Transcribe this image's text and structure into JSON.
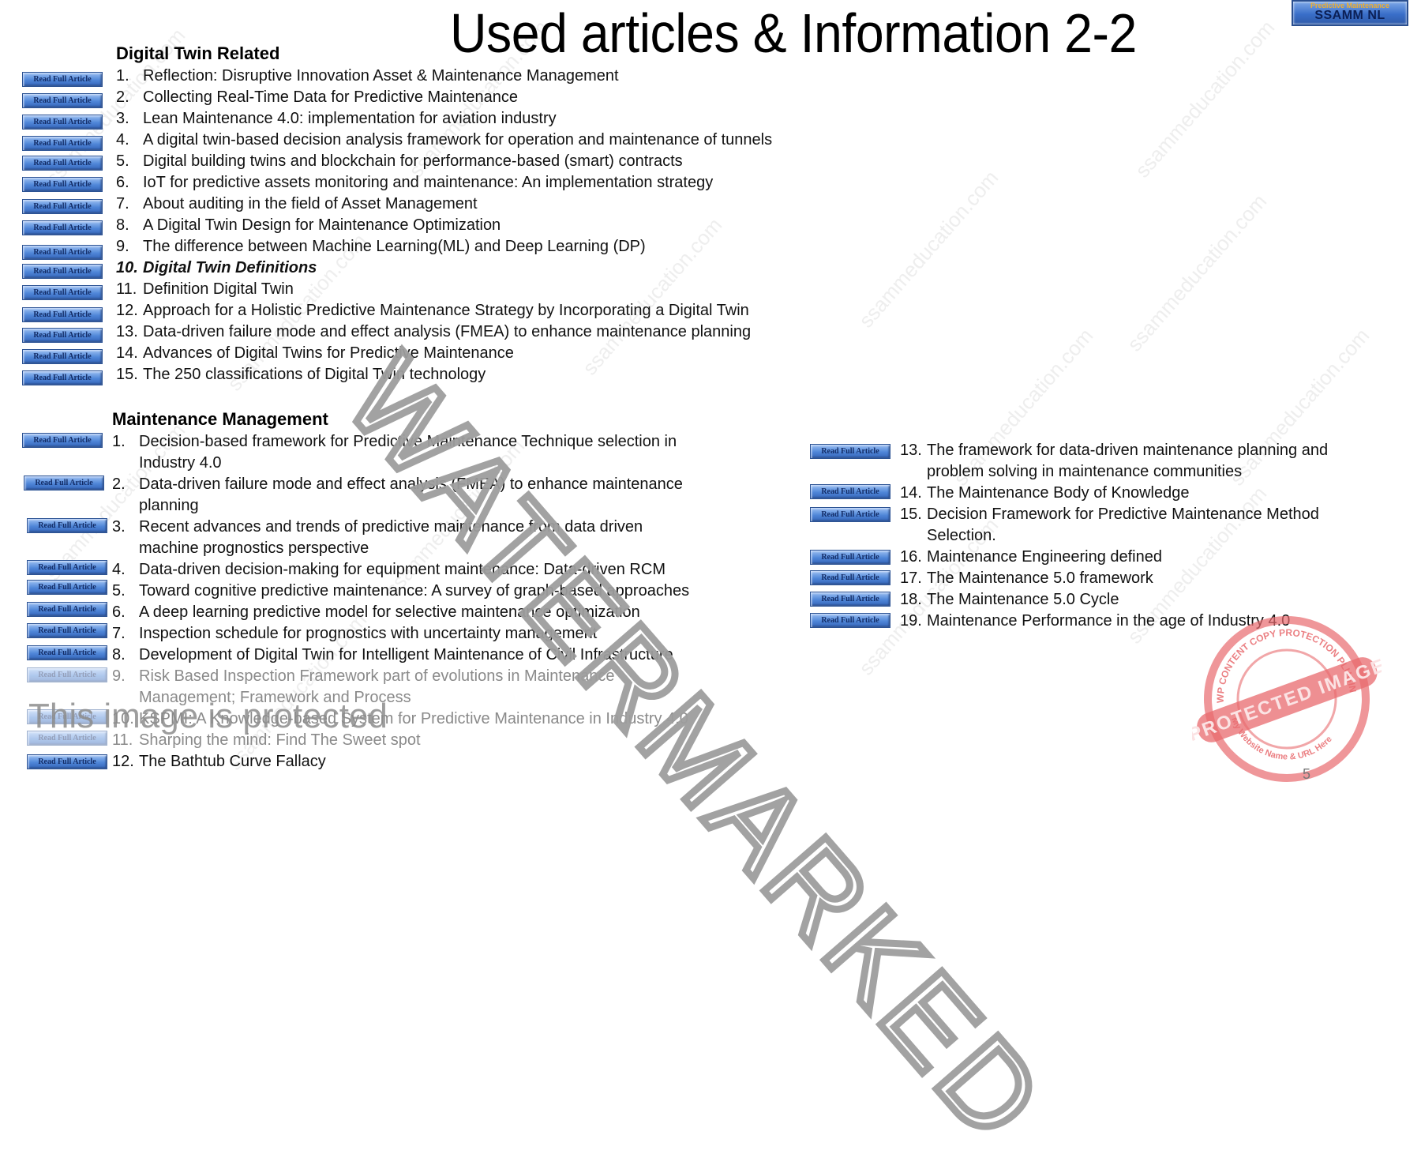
{
  "slide": {
    "title": "Used articles & Information 2-2",
    "page_number": "5",
    "logo": {
      "top_text": "Predictive Maintenance",
      "main_text": "SSAMM NL"
    },
    "button_label": "Read Full Article"
  },
  "digital_twin": {
    "heading": "Digital Twin Related",
    "items": [
      {
        "num": "1.",
        "text": "Reflection: Disruptive Innovation Asset & Maintenance Management"
      },
      {
        "num": "2.",
        "text": "Collecting Real-Time Data for Predictive Maintenance"
      },
      {
        "num": "3.",
        "text": "Lean Maintenance 4.0: implementation for aviation industry"
      },
      {
        "num": "4.",
        "text": "A digital twin-based decision analysis framework for operation and maintenance of tunnels"
      },
      {
        "num": "5.",
        "text": "Digital building twins and blockchain for performance-based (smart) contracts"
      },
      {
        "num": "6.",
        "text": "IoT for predictive assets monitoring and maintenance: An implementation strategy"
      },
      {
        "num": "7.",
        "text": "About auditing in the field of Asset Management"
      },
      {
        "num": "8.",
        "text": "A Digital Twin Design for Maintenance Optimization"
      },
      {
        "num": "9.",
        "text": "The difference between Machine Learning(ML) and Deep Learning (DP)"
      },
      {
        "num": "10.",
        "text": "Digital Twin Definitions"
      },
      {
        "num": "11.",
        "text": "Definition Digital Twin"
      },
      {
        "num": "12.",
        "text": "Approach for a Holistic Predictive Maintenance Strategy by Incorporating a Digital Twin"
      },
      {
        "num": "13.",
        "text": "Data-driven failure mode and effect analysis (FMEA) to enhance maintenance planning"
      },
      {
        "num": "14.",
        "text": "Advances of Digital Twins for Predictive Maintenance"
      },
      {
        "num": "15.",
        "text": "The 250 classifications of Digital Twin technology"
      }
    ]
  },
  "maintenance": {
    "heading": "Maintenance Management",
    "left_items": [
      {
        "num": "1.",
        "text": "Decision-based framework for Predictive Maintenance Technique selection in Industry 4.0"
      },
      {
        "num": "2.",
        "text": "Data-driven failure mode and effect analysis (FMEA) to enhance maintenance planning"
      },
      {
        "num": "3.",
        "text": "Recent advances and trends of predictive maintenance from data driven machine prognostics perspective"
      },
      {
        "num": "4.",
        "text": "Data-driven decision-making for equipment maintenance: Data-driven RCM"
      },
      {
        "num": "5.",
        "text": "Toward cognitive predictive maintenance: A survey of graph-based approaches"
      },
      {
        "num": "6.",
        "text": "A deep learning predictive model for selective maintenance optimization"
      },
      {
        "num": "7.",
        "text": "Inspection schedule for prognostics with uncertainty management"
      },
      {
        "num": "8.",
        "text": "Development of Digital Twin for Intelligent Maintenance of Civil Infrastructure"
      },
      {
        "num": "9.",
        "text": "Risk Based Inspection Framework part of evolutions in Maintenance Management; Framework and Process"
      },
      {
        "num": "10.",
        "text": "KSPMI: A Knowledge-based System for Predictive Maintenance in Industry 4.0"
      },
      {
        "num": "11.",
        "text": "Sharping the mind: Find The Sweet spot"
      },
      {
        "num": "12.",
        "text": "The Bathtub Curve Fallacy"
      }
    ],
    "right_items": [
      {
        "num": "13.",
        "text": "The framework for data-driven maintenance planning and problem solving in maintenance communities"
      },
      {
        "num": "14.",
        "text": "The Maintenance Body of Knowledge"
      },
      {
        "num": "15.",
        "text": "Decision Framework for Predictive Maintenance Method Selection."
      },
      {
        "num": "16.",
        "text": "Maintenance Engineering defined"
      },
      {
        "num": "17.",
        "text": "The Maintenance 5.0 framework"
      },
      {
        "num": "18.",
        "text": "The Maintenance 5.0 Cycle"
      },
      {
        "num": "19.",
        "text": "Maintenance Performance in the age of Industry 4.0"
      }
    ]
  },
  "watermarks": {
    "diagonal": "WATERMARKED",
    "tiled": "ssammeducation.com",
    "protected_notice": "This image is protected",
    "stamp_top": "WP CONTENT COPY PROTECTION PLUGIN",
    "stamp_band": "PROTECTED IMAGE",
    "stamp_bottom": "My Website Name & URL Here",
    "stamp_color": "#e86a6e"
  }
}
